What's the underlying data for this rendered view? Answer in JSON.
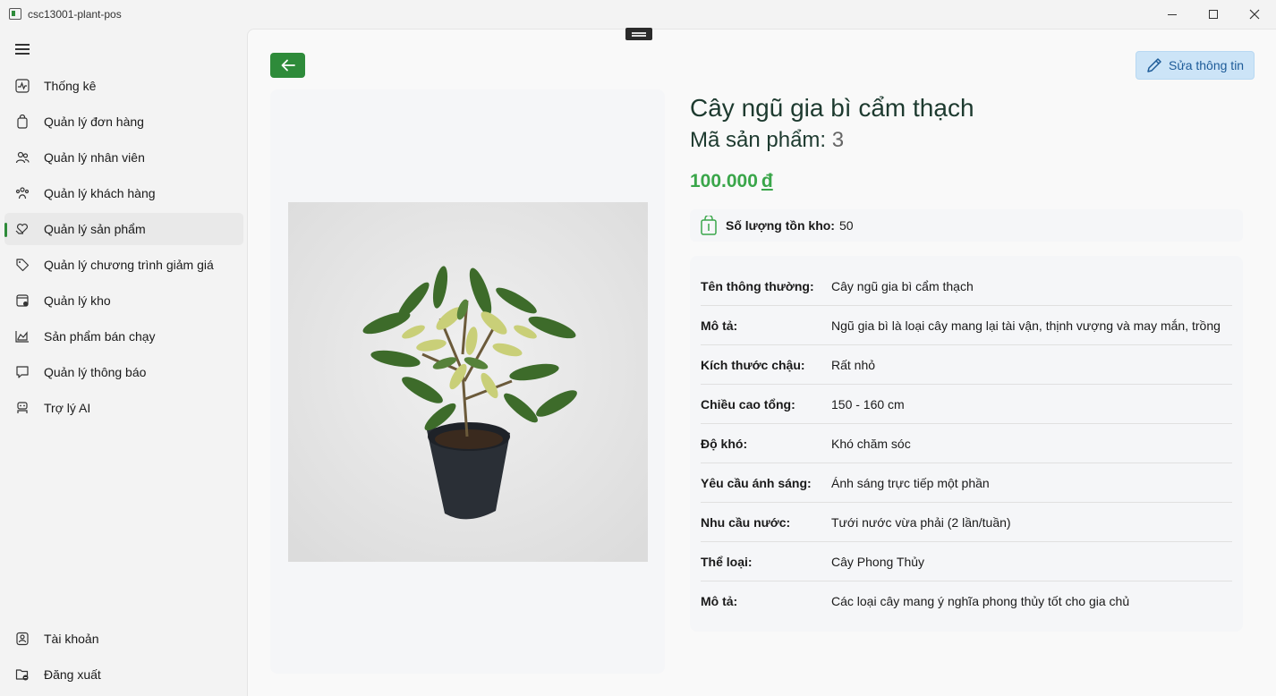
{
  "window": {
    "title": "csc13001-plant-pos"
  },
  "sidebar": {
    "items": [
      {
        "label": "Thống kê",
        "icon": "chart-pulse-icon"
      },
      {
        "label": "Quản lý đơn hàng",
        "icon": "shopping-bag-icon"
      },
      {
        "label": "Quản lý nhân viên",
        "icon": "people-icon"
      },
      {
        "label": "Quản lý khách hàng",
        "icon": "people-team-icon"
      },
      {
        "label": "Quản lý sản phẩm",
        "icon": "heart-hand-icon",
        "active": true
      },
      {
        "label": "Quản lý chương trình giảm giá",
        "icon": "tag-icon"
      },
      {
        "label": "Quản lý kho",
        "icon": "warehouse-icon"
      },
      {
        "label": "Sản phẩm bán chạy",
        "icon": "area-chart-icon"
      },
      {
        "label": "Quản lý thông báo",
        "icon": "chat-bubble-icon"
      },
      {
        "label": "Trợ lý AI",
        "icon": "bot-icon"
      }
    ],
    "footer": [
      {
        "label": "Tài khoản",
        "icon": "person-square-icon"
      },
      {
        "label": "Đăng xuất",
        "icon": "folder-logout-icon"
      }
    ],
    "accent": "#2e8b3a"
  },
  "toolbar": {
    "edit_label": "Sửa thông tin"
  },
  "product": {
    "name": "Cây ngũ gia bì cẩm thạch",
    "code_label": "Mã sản phẩm:",
    "code_value": "3",
    "price": "100.000",
    "currency": "đ",
    "stock_label": "Số lượng tồn kho:",
    "stock_value": "50",
    "details": [
      {
        "key": "Tên thông thường:",
        "value": "Cây ngũ gia bì cẩm thạch"
      },
      {
        "key": "Mô tả:",
        "value": "Ngũ gia bì là loại cây mang lại tài vận, thịnh vượng và may mắn, trồng"
      },
      {
        "key": "Kích thước chậu:",
        "value": "Rất nhỏ"
      },
      {
        "key": "Chiều cao tổng:",
        "value": "150 - 160 cm"
      },
      {
        "key": "Độ khó:",
        "value": "Khó chăm sóc"
      },
      {
        "key": "Yêu cầu ánh sáng:",
        "value": "Ánh sáng trực tiếp một phần"
      },
      {
        "key": "Nhu cầu nước:",
        "value": "Tưới nước vừa phải (2 lần/tuần)"
      },
      {
        "key": "Thể loại:",
        "value": "Cây Phong Thủy"
      },
      {
        "key": "Mô tả:",
        "value": "Các loại cây mang ý nghĩa phong thủy tốt cho gia chủ"
      }
    ]
  },
  "colors": {
    "price": "#3aa64a",
    "primary": "#2e8b3a",
    "edit_bg": "#cce4f7"
  }
}
